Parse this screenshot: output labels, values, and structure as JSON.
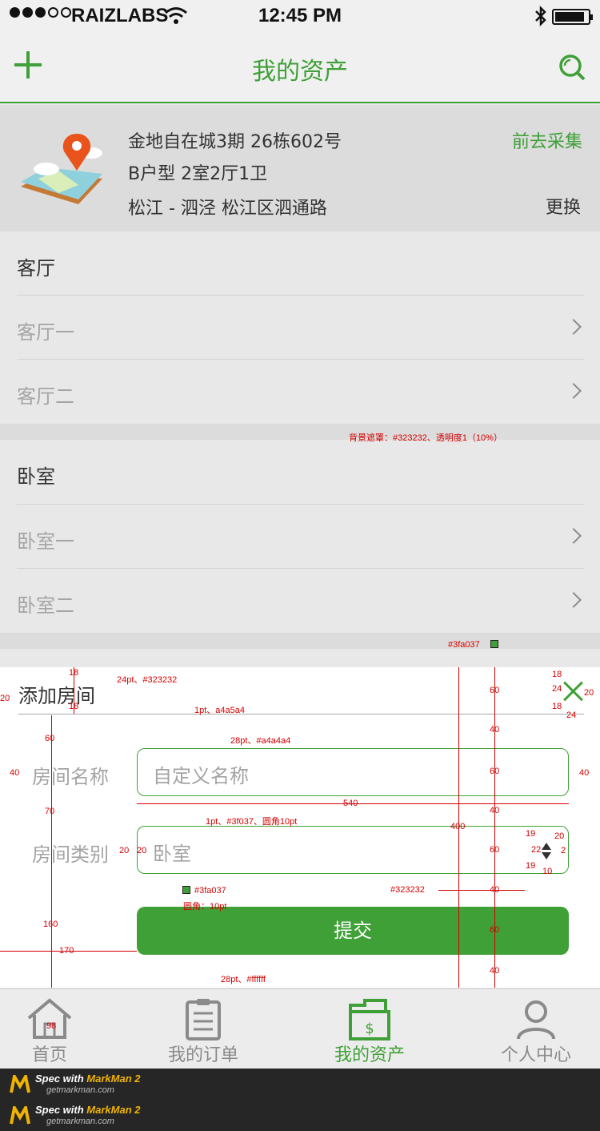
{
  "status_bar": {
    "carrier": "RAIZLABS",
    "time": "12:45 PM",
    "signal_bars": 3,
    "signal_total": 5,
    "battery_level": 0.9
  },
  "nav": {
    "title": "我的资产"
  },
  "address": {
    "line1": "金地自在城3期    26栋602号",
    "line2": "B户型  2室2厅1卫",
    "line3": "松江 - 泗泾 松江区泗通路",
    "collect_label": "前去采集",
    "change_label": "更换"
  },
  "sections": [
    {
      "title": "客厅",
      "rows": [
        "客厅一",
        "客厅二"
      ]
    },
    {
      "title": "卧室",
      "rows": [
        "卧室一",
        "卧室二"
      ]
    }
  ],
  "modal": {
    "title": "添加房间",
    "name_label": "房间名称",
    "name_placeholder": "自定义名称",
    "type_label": "房间类别",
    "type_value": "卧室",
    "submit_label": "提交"
  },
  "annotations": {
    "mask": "背景遮罩：#323232、透明度1（10%）",
    "title_font": "24pt、#323232",
    "divider": "1pt、a4a5a4",
    "input_font": "28pt、#a4a4a4",
    "border": "1pt、#3f037、圆角10pt",
    "close_color": "#3fa037",
    "btn_color": "#3fa037",
    "btn_radius": "圆角：10pt",
    "arrow_color": "#323232",
    "btn_font": "28pt、#ffffff",
    "n18a": "18",
    "n18b": "18",
    "n20a": "20",
    "n60a": "60",
    "n40a": "40",
    "n70": "70",
    "n160": "160",
    "n170": "170",
    "n98": "98",
    "n540": "540",
    "n400": "400",
    "n60b": "60",
    "n40b": "40",
    "n60c": "60",
    "n40c": "40",
    "n60d": "60",
    "n40d": "40",
    "n60e": "60",
    "n40e": "40",
    "n18c": "18",
    "n24a": "24",
    "n18d": "18",
    "n24b": "24",
    "n20b": "20",
    "n40f": "40",
    "n19a": "19",
    "n22": "22",
    "n19b": "19",
    "n10": "10",
    "n20c": "20",
    "n2": "2",
    "n20d": "20",
    "n20e": "20"
  },
  "tabs": [
    {
      "label": "首页",
      "icon": "home-icon",
      "active": false
    },
    {
      "label": "我的订单",
      "icon": "clipboard-icon",
      "active": false
    },
    {
      "label": "我的资产",
      "icon": "briefcase-dollar-icon",
      "active": true
    },
    {
      "label": "个人中心",
      "icon": "user-icon",
      "active": false
    }
  ],
  "footer": {
    "spec_prefix": "Spec with ",
    "brand": "MarkMan 2",
    "site": "getmarkman.com"
  },
  "colors": {
    "accent": "#3fa037",
    "text": "#323232",
    "muted": "#a4a4a4",
    "divider": "#a4a5a4"
  }
}
